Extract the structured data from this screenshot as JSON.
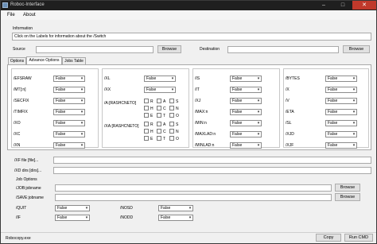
{
  "window": {
    "title": "Roboc-Interface"
  },
  "menu": [
    "File",
    "About"
  ],
  "info": {
    "group_label": "Information",
    "text": "Click on the Labels for information about the /Switch"
  },
  "paths": {
    "source_label": "Source",
    "dest_label": "Destination",
    "browse": "Browse"
  },
  "tabs": [
    "Options",
    "Advance Options",
    "Jobs Table"
  ],
  "col1": [
    {
      "label": "/EFSRAW",
      "value": "False"
    },
    {
      "label": "/MT[:n]",
      "value": "False"
    },
    {
      "label": "/SECFIX",
      "value": "False"
    },
    {
      "label": "/TIMFIX",
      "value": "False"
    },
    {
      "label": "/XO",
      "value": "False"
    },
    {
      "label": "/XC",
      "value": "False"
    },
    {
      "label": "/XN",
      "value": "False"
    }
  ],
  "col2": [
    {
      "label": "/XL",
      "value": "False"
    },
    {
      "label": "/XX",
      "value": "False"
    }
  ],
  "attr": {
    "a_label": "/A:[RASHCNETO]",
    "xa_label": "/XA:[RASHCNETO]",
    "letters": [
      "R",
      "A",
      "S",
      "H",
      "C",
      "N",
      "E",
      "T",
      "O"
    ]
  },
  "col3": [
    {
      "label": "/IS",
      "value": "False"
    },
    {
      "label": "/IT",
      "value": "False"
    },
    {
      "label": "/XJ",
      "value": "False"
    },
    {
      "label": "/MAX:n",
      "value": "False"
    },
    {
      "label": "/MIN:n",
      "value": "False"
    },
    {
      "label": "/MAXLAD:n",
      "value": "False"
    },
    {
      "label": "/MINLAD:n",
      "value": "False"
    }
  ],
  "col4": [
    {
      "label": "/BYTES",
      "value": "False"
    },
    {
      "label": "/X",
      "value": "False"
    },
    {
      "label": "/V",
      "value": "False"
    },
    {
      "label": "/ETA",
      "value": "False"
    },
    {
      "label": "/SL",
      "value": "False"
    },
    {
      "label": "/XJD",
      "value": "False"
    },
    {
      "label": "/XJF",
      "value": "False"
    }
  ],
  "xf": {
    "label": "/XF file [file]..."
  },
  "xd": {
    "label": "/XD dirs [dirs]..."
  },
  "jobs": {
    "group_label": "Job Options",
    "job_label": "/JOB:jobname",
    "save_label": "/SAVE:jobname",
    "browse": "Browse",
    "quit": {
      "label": "/QUIT",
      "value": "False"
    },
    "if": {
      "label": "/IF",
      "value": "False"
    },
    "nosd": {
      "label": "/NOSD",
      "value": "False"
    },
    "nodd": {
      "label": "/NODD",
      "value": "False"
    }
  },
  "status": {
    "text": "Robocopy.exe",
    "copy": "Copy",
    "run": "Run CMD"
  }
}
